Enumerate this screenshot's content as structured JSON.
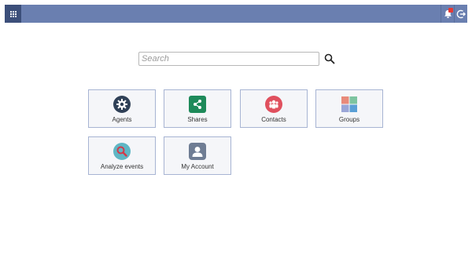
{
  "topbar": {
    "apps_icon": "apps-grid-icon",
    "notifications_icon": "bell-icon",
    "logout_icon": "logout-icon",
    "bar_color": "#6a7fb0",
    "apps_color": "#3c4f7a"
  },
  "search": {
    "placeholder": "Search",
    "value": "",
    "icon": "search-icon"
  },
  "tiles": [
    {
      "label": "Agents",
      "icon": "gear-icon",
      "color": "#2f4057"
    },
    {
      "label": "Shares",
      "icon": "share-icon",
      "color": "#1e8a5a"
    },
    {
      "label": "Contacts",
      "icon": "contacts-icon",
      "color": "#e0505e"
    },
    {
      "label": "Groups",
      "icon": "groups-icon",
      "color": "#e88a7a"
    },
    {
      "label": "Analyze events",
      "icon": "analyze-icon",
      "color": "#5fb6c4"
    },
    {
      "label": "My Account",
      "icon": "user-icon",
      "color": "#6f7d94"
    }
  ]
}
